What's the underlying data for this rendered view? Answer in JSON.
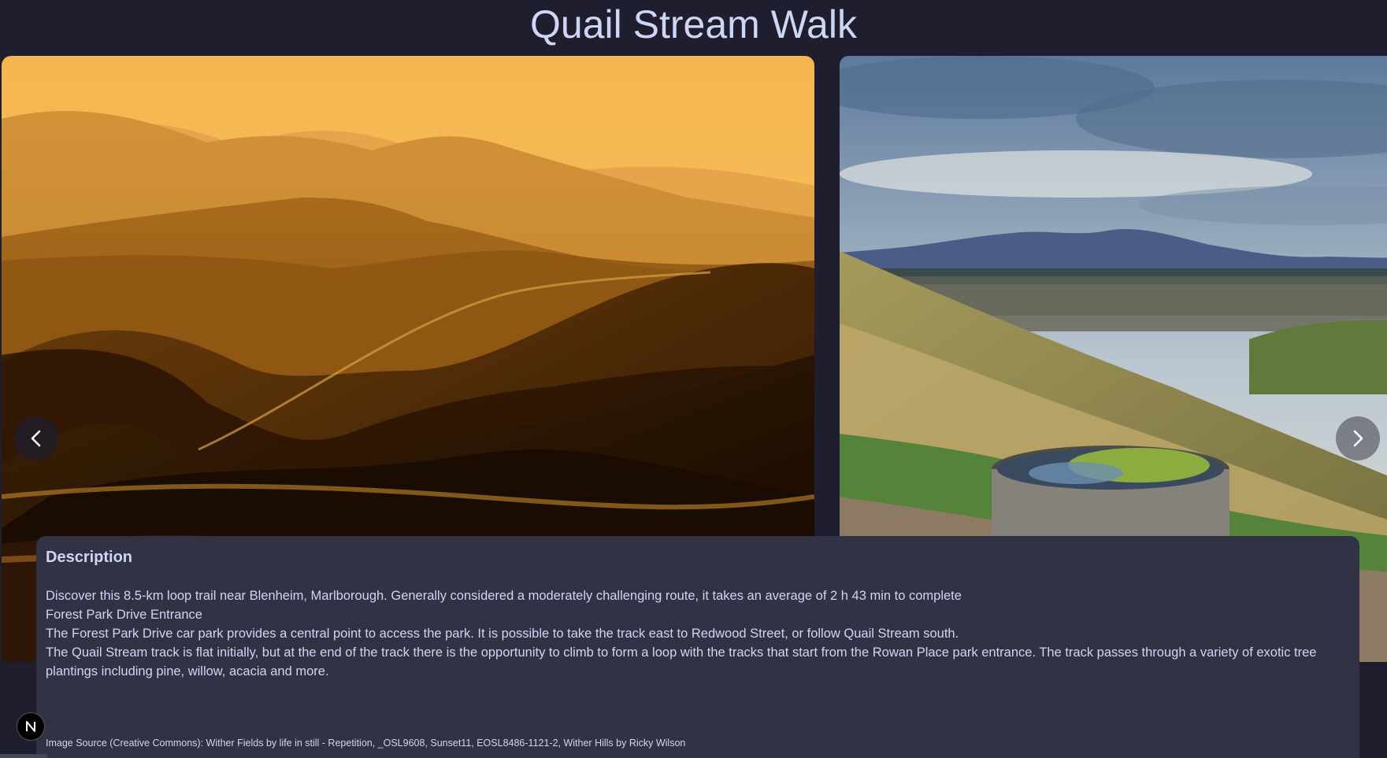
{
  "page": {
    "title": "Quail Stream Walk"
  },
  "carousel": {
    "prev_icon": "chevron-left-icon",
    "next_icon": "chevron-right-icon"
  },
  "description": {
    "heading": "Description",
    "paragraphs": [
      "Discover this 8.5-km loop trail near Blenheim, Marlborough. Generally considered a moderately challenging route, it takes an average of 2 h 43 min to complete",
      "Forest Park Drive Entrance",
      "The Forest Park Drive car park provides a central point to access the park. It is possible to take the track east to Redwood Street, or follow Quail Stream south.",
      "The Quail Stream track is flat initially, but at the end of the track there is the opportunity to climb to form a loop with the tracks that start from the Rowan Place park entrance. The track passes through a variety of exotic tree plantings including pine, willow, acacia and more."
    ],
    "image_source": "Image Source (Creative Commons): Wither Fields by life in still - Repetition, _OSL9608, Sunset11, EOSL8486-1121-2, Wither Hills by Ricky Wilson"
  },
  "badge": {
    "letter": "N"
  },
  "colors": {
    "background": "#1e1e2e",
    "panel": "#313244",
    "text": "#cdd6f4"
  }
}
